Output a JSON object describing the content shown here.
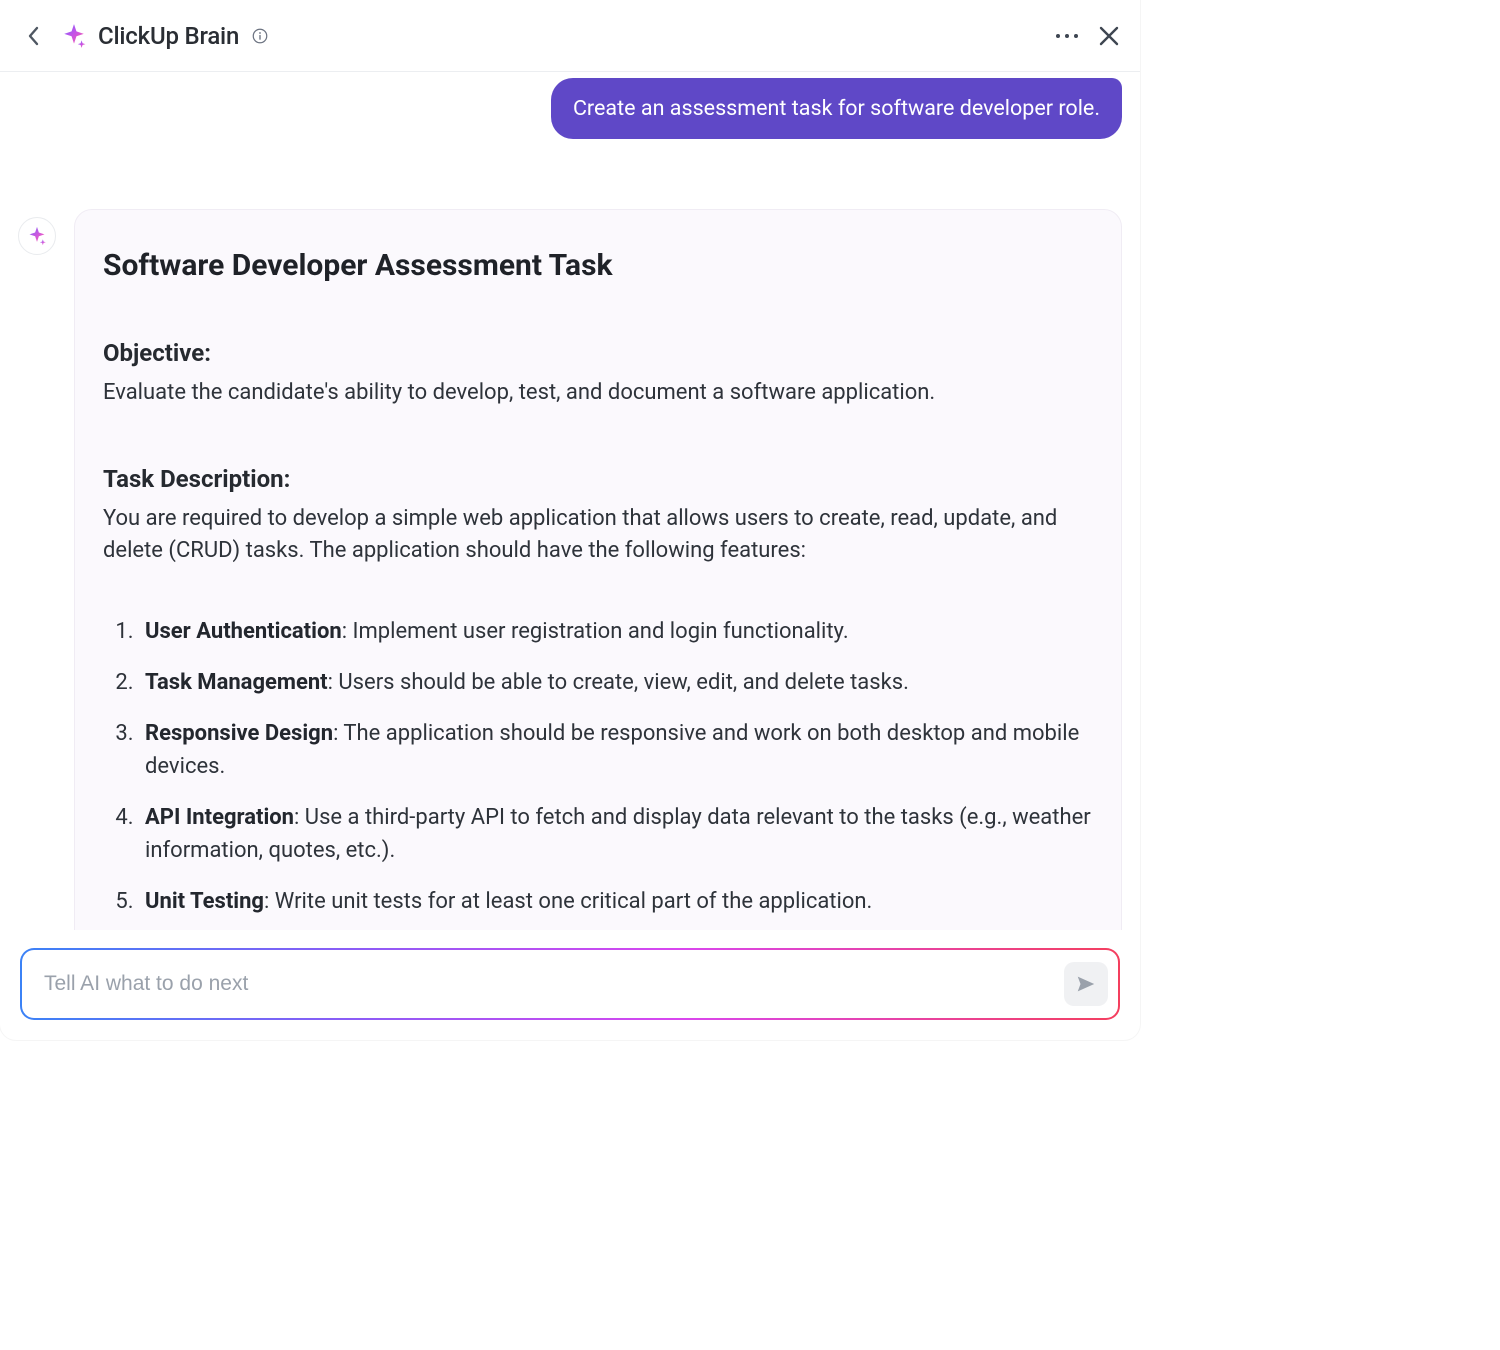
{
  "header": {
    "title": "ClickUp Brain"
  },
  "conversation": {
    "user_message": "Create an assessment task for software developer role.",
    "ai": {
      "title": "Software Developer Assessment Task",
      "objective_heading": "Objective:",
      "objective_text": "Evaluate the candidate's ability to develop, test, and document a software application.",
      "task_heading": "Task Description:",
      "task_text": "You are required to develop a simple web application that allows users to create, read, update, and delete (CRUD) tasks. The application should have the following features:",
      "features": [
        {
          "num": "1.",
          "name": "User Authentication",
          "desc": ": Implement user registration and login functionality."
        },
        {
          "num": "2.",
          "name": "Task Management",
          "desc": ": Users should be able to create, view, edit, and delete tasks."
        },
        {
          "num": "3.",
          "name": "Responsive Design",
          "desc": ": The application should be responsive and work on both desktop and mobile devices."
        },
        {
          "num": "4.",
          "name": "API Integration",
          "desc": ": Use a third-party API to fetch and display data relevant to the tasks (e.g., weather information, quotes, etc.)."
        },
        {
          "num": "5.",
          "name": "Unit Testing",
          "desc": ": Write unit tests for at least one critical part of the application."
        }
      ]
    }
  },
  "composer": {
    "placeholder": "Tell AI what to do next"
  }
}
